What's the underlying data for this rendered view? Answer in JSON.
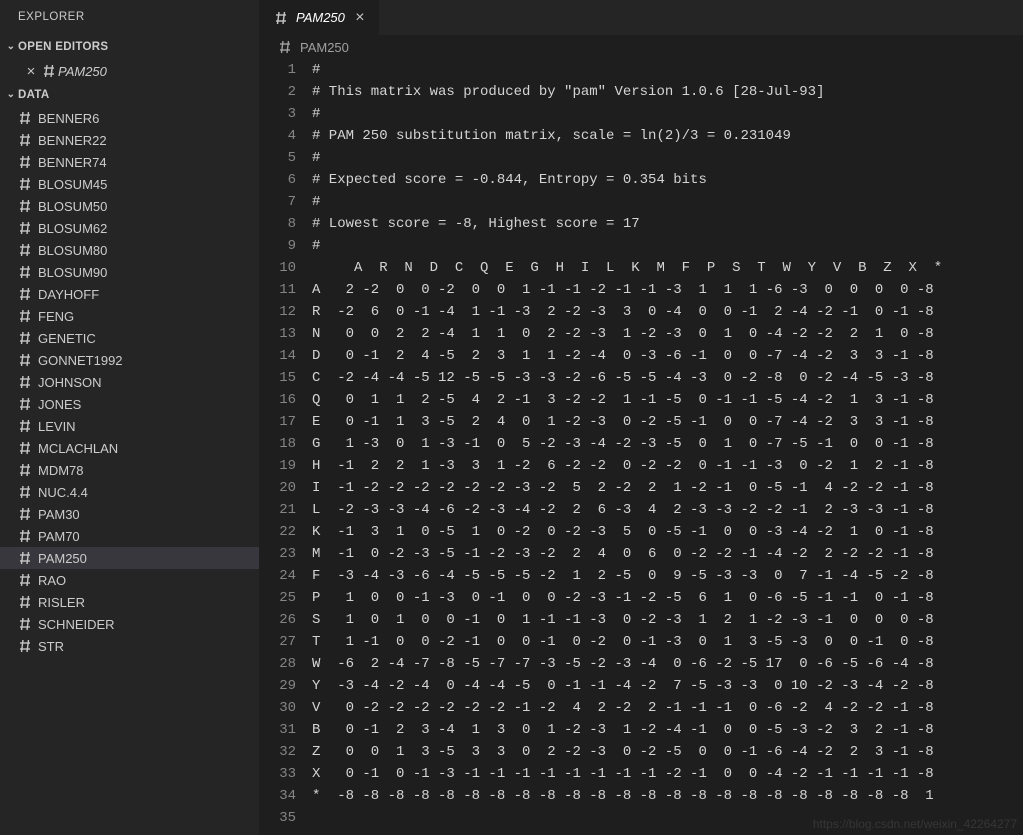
{
  "explorer_label": "EXPLORER",
  "open_editors_label": "OPEN EDITORS",
  "open_editor_item": "PAM250",
  "data_section_label": "DATA",
  "tree_items": [
    "BENNER6",
    "BENNER22",
    "BENNER74",
    "BLOSUM45",
    "BLOSUM50",
    "BLOSUM62",
    "BLOSUM80",
    "BLOSUM90",
    "DAYHOFF",
    "FENG",
    "GENETIC",
    "GONNET1992",
    "JOHNSON",
    "JONES",
    "LEVIN",
    "MCLACHLAN",
    "MDM78",
    "NUC.4.4",
    "PAM30",
    "PAM70",
    "PAM250",
    "RAO",
    "RISLER",
    "SCHNEIDER",
    "STR"
  ],
  "tab_label": "PAM250",
  "breadcrumb": "PAM250",
  "watermark": "https://blog.csdn.net/weixin_42264277",
  "code": {
    "comments": [
      "#",
      "# This matrix was produced by \"pam\" Version 1.0.6 [28-Jul-93]",
      "#",
      "# PAM 250 substitution matrix, scale = ln(2)/3 = 0.231049",
      "#",
      "# Expected score = -0.844, Entropy = 0.354 bits",
      "#",
      "# Lowest score = -8, Highest score = 17",
      "#"
    ],
    "header": [
      "A",
      "R",
      "N",
      "D",
      "C",
      "Q",
      "E",
      "G",
      "H",
      "I",
      "L",
      "K",
      "M",
      "F",
      "P",
      "S",
      "T",
      "W",
      "Y",
      "V",
      "B",
      "Z",
      "X",
      "*"
    ],
    "chart_data": {
      "type": "table",
      "title": "PAM 250 substitution matrix",
      "columns": [
        "A",
        "R",
        "N",
        "D",
        "C",
        "Q",
        "E",
        "G",
        "H",
        "I",
        "L",
        "K",
        "M",
        "F",
        "P",
        "S",
        "T",
        "W",
        "Y",
        "V",
        "B",
        "Z",
        "X",
        "*"
      ],
      "rows": [
        {
          "label": "A",
          "values": [
            2,
            -2,
            0,
            0,
            -2,
            0,
            0,
            1,
            -1,
            -1,
            -2,
            -1,
            -1,
            -3,
            1,
            1,
            1,
            -6,
            -3,
            0,
            0,
            0,
            0,
            -8
          ]
        },
        {
          "label": "R",
          "values": [
            -2,
            6,
            0,
            -1,
            -4,
            1,
            -1,
            -3,
            2,
            -2,
            -3,
            3,
            0,
            -4,
            0,
            0,
            -1,
            2,
            -4,
            -2,
            -1,
            0,
            -1,
            -8
          ]
        },
        {
          "label": "N",
          "values": [
            0,
            0,
            2,
            2,
            -4,
            1,
            1,
            0,
            2,
            -2,
            -3,
            1,
            -2,
            -3,
            0,
            1,
            0,
            -4,
            -2,
            -2,
            2,
            1,
            0,
            -8
          ]
        },
        {
          "label": "D",
          "values": [
            0,
            -1,
            2,
            4,
            -5,
            2,
            3,
            1,
            1,
            -2,
            -4,
            0,
            -3,
            -6,
            -1,
            0,
            0,
            -7,
            -4,
            -2,
            3,
            3,
            -1,
            -8
          ]
        },
        {
          "label": "C",
          "values": [
            -2,
            -4,
            -4,
            -5,
            12,
            -5,
            -5,
            -3,
            -3,
            -2,
            -6,
            -5,
            -5,
            -4,
            -3,
            0,
            -2,
            -8,
            0,
            -2,
            -4,
            -5,
            -3,
            -8
          ]
        },
        {
          "label": "Q",
          "values": [
            0,
            1,
            1,
            2,
            -5,
            4,
            2,
            -1,
            3,
            -2,
            -2,
            1,
            -1,
            -5,
            0,
            -1,
            -1,
            -5,
            -4,
            -2,
            1,
            3,
            -1,
            -8
          ]
        },
        {
          "label": "E",
          "values": [
            0,
            -1,
            1,
            3,
            -5,
            2,
            4,
            0,
            1,
            -2,
            -3,
            0,
            -2,
            -5,
            -1,
            0,
            0,
            -7,
            -4,
            -2,
            3,
            3,
            -1,
            -8
          ]
        },
        {
          "label": "G",
          "values": [
            1,
            -3,
            0,
            1,
            -3,
            -1,
            0,
            5,
            -2,
            -3,
            -4,
            -2,
            -3,
            -5,
            0,
            1,
            0,
            -7,
            -5,
            -1,
            0,
            0,
            -1,
            -8
          ]
        },
        {
          "label": "H",
          "values": [
            -1,
            2,
            2,
            1,
            -3,
            3,
            1,
            -2,
            6,
            -2,
            -2,
            0,
            -2,
            -2,
            0,
            -1,
            -1,
            -3,
            0,
            -2,
            1,
            2,
            -1,
            -8
          ]
        },
        {
          "label": "I",
          "values": [
            -1,
            -2,
            -2,
            -2,
            -2,
            -2,
            -2,
            -3,
            -2,
            5,
            2,
            -2,
            2,
            1,
            -2,
            -1,
            0,
            -5,
            -1,
            4,
            -2,
            -2,
            -1,
            -8
          ]
        },
        {
          "label": "L",
          "values": [
            -2,
            -3,
            -3,
            -4,
            -6,
            -2,
            -3,
            -4,
            -2,
            2,
            6,
            -3,
            4,
            2,
            -3,
            -3,
            -2,
            -2,
            -1,
            2,
            -3,
            -3,
            -1,
            -8
          ]
        },
        {
          "label": "K",
          "values": [
            -1,
            3,
            1,
            0,
            -5,
            1,
            0,
            -2,
            0,
            -2,
            -3,
            5,
            0,
            -5,
            -1,
            0,
            0,
            -3,
            -4,
            -2,
            1,
            0,
            -1,
            -8
          ]
        },
        {
          "label": "M",
          "values": [
            -1,
            0,
            -2,
            -3,
            -5,
            -1,
            -2,
            -3,
            -2,
            2,
            4,
            0,
            6,
            0,
            -2,
            -2,
            -1,
            -4,
            -2,
            2,
            -2,
            -2,
            -1,
            -8
          ]
        },
        {
          "label": "F",
          "values": [
            -3,
            -4,
            -3,
            -6,
            -4,
            -5,
            -5,
            -5,
            -2,
            1,
            2,
            -5,
            0,
            9,
            -5,
            -3,
            -3,
            0,
            7,
            -1,
            -4,
            -5,
            -2,
            -8
          ]
        },
        {
          "label": "P",
          "values": [
            1,
            0,
            0,
            -1,
            -3,
            0,
            -1,
            0,
            0,
            -2,
            -3,
            -1,
            -2,
            -5,
            6,
            1,
            0,
            -6,
            -5,
            -1,
            -1,
            0,
            -1,
            -8
          ]
        },
        {
          "label": "S",
          "values": [
            1,
            0,
            1,
            0,
            0,
            -1,
            0,
            1,
            -1,
            -1,
            -3,
            0,
            -2,
            -3,
            1,
            2,
            1,
            -2,
            -3,
            -1,
            0,
            0,
            0,
            -8
          ]
        },
        {
          "label": "T",
          "values": [
            1,
            -1,
            0,
            0,
            -2,
            -1,
            0,
            0,
            -1,
            0,
            -2,
            0,
            -1,
            -3,
            0,
            1,
            3,
            -5,
            -3,
            0,
            0,
            -1,
            0,
            -8
          ]
        },
        {
          "label": "W",
          "values": [
            -6,
            2,
            -4,
            -7,
            -8,
            -5,
            -7,
            -7,
            -3,
            -5,
            -2,
            -3,
            -4,
            0,
            -6,
            -2,
            -5,
            17,
            0,
            -6,
            -5,
            -6,
            -4,
            -8
          ]
        },
        {
          "label": "Y",
          "values": [
            -3,
            -4,
            -2,
            -4,
            0,
            -4,
            -4,
            -5,
            0,
            -1,
            -1,
            -4,
            -2,
            7,
            -5,
            -3,
            -3,
            0,
            10,
            -2,
            -3,
            -4,
            -2,
            -8
          ]
        },
        {
          "label": "V",
          "values": [
            0,
            -2,
            -2,
            -2,
            -2,
            -2,
            -2,
            -1,
            -2,
            4,
            2,
            -2,
            2,
            -1,
            -1,
            -1,
            0,
            -6,
            -2,
            4,
            -2,
            -2,
            -1,
            -8
          ]
        },
        {
          "label": "B",
          "values": [
            0,
            -1,
            2,
            3,
            -4,
            1,
            3,
            0,
            1,
            -2,
            -3,
            1,
            -2,
            -4,
            -1,
            0,
            0,
            -5,
            -3,
            -2,
            3,
            2,
            -1,
            -8
          ]
        },
        {
          "label": "Z",
          "values": [
            0,
            0,
            1,
            3,
            -5,
            3,
            3,
            0,
            2,
            -2,
            -3,
            0,
            -2,
            -5,
            0,
            0,
            -1,
            -6,
            -4,
            -2,
            2,
            3,
            -1,
            -8
          ]
        },
        {
          "label": "X",
          "values": [
            0,
            -1,
            0,
            -1,
            -3,
            -1,
            -1,
            -1,
            -1,
            -1,
            -1,
            -1,
            -1,
            -2,
            -1,
            0,
            0,
            -4,
            -2,
            -1,
            -1,
            -1,
            -1,
            -8
          ]
        },
        {
          "label": "*",
          "values": [
            -8,
            -8,
            -8,
            -8,
            -8,
            -8,
            -8,
            -8,
            -8,
            -8,
            -8,
            -8,
            -8,
            -8,
            -8,
            -8,
            -8,
            -8,
            -8,
            -8,
            -8,
            -8,
            -8,
            1
          ]
        }
      ]
    }
  }
}
